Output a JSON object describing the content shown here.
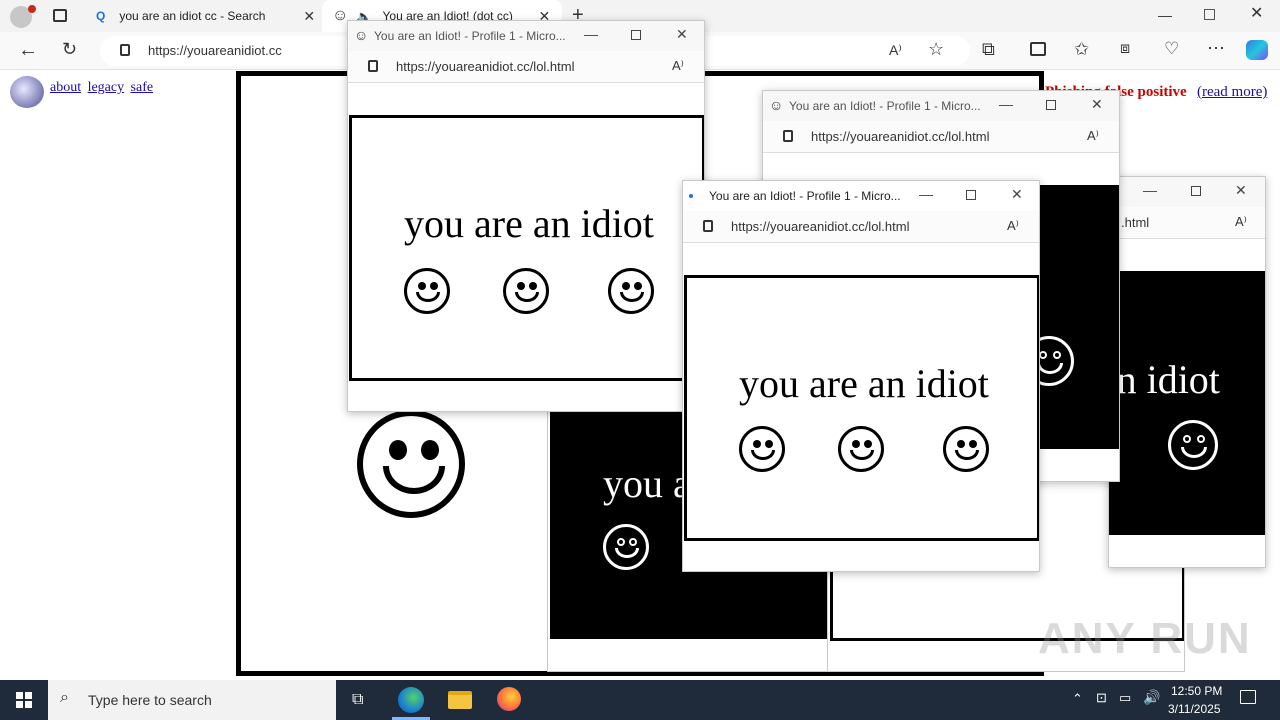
{
  "browser": {
    "tabs": [
      {
        "label": "you are an idiot cc - Search",
        "icon": "search-icon",
        "active": false
      },
      {
        "label": "You are an Idiot! (dot cc)",
        "icon": "smiley-icon",
        "active": true
      }
    ],
    "url": "https://youareanidiot.cc"
  },
  "page": {
    "links": [
      "about",
      "legacy",
      "safe"
    ],
    "notice_bold": "Phishing false positive",
    "notice_link": "(read more)",
    "black_window_text": "you are an idiot",
    "back_text": "you a"
  },
  "popups": [
    {
      "title": "You are an Idiot! - Profile 1 - Micro...",
      "url": "https://youareanidiot.cc/lol.html",
      "text": "you are an idiot"
    },
    {
      "title": "You are an Idiot! - Profile 1 - Micro...",
      "url": "https://youareanidiot.cc/lol.html",
      "text": "you are an idiot"
    },
    {
      "title": "You are an Idiot! - Profile 1 - Micro...",
      "url": "https://youareanidiot.cc/lol.html",
      "text": "you are an idiot"
    },
    {
      "url": ".html"
    }
  ],
  "taskbar": {
    "search_placeholder": "Type here to search",
    "time": "12:50 PM",
    "date": "3/11/2025"
  },
  "watermark": "ANY RUN"
}
